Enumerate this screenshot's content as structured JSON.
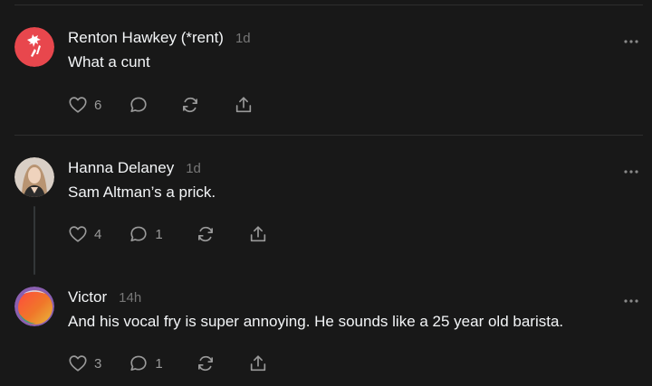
{
  "posts": [
    {
      "username": "Renton Hawkey (*rent)",
      "time": "1d",
      "text": "What a cunt",
      "likes": "6",
      "replies": "",
      "avatar_color": "#e8474d"
    },
    {
      "username": "Hanna Delaney",
      "time": "1d",
      "text": "Sam Altman’s a prick.",
      "likes": "4",
      "replies": "1",
      "avatar_color": "#c8a98e"
    },
    {
      "username": "Victor",
      "time": "14h",
      "text": "And his vocal fry is super annoying. He sounds like a 25 year old barista.",
      "likes": "3",
      "replies": "1",
      "avatar_color": "#f06a2a"
    }
  ],
  "icons": {
    "like": "heart-icon",
    "reply": "comment-icon",
    "repost": "repost-icon",
    "share": "share-icon",
    "more": "more-icon"
  },
  "colors": {
    "background": "#181818",
    "text": "#f3f5f7",
    "muted": "#777777"
  }
}
